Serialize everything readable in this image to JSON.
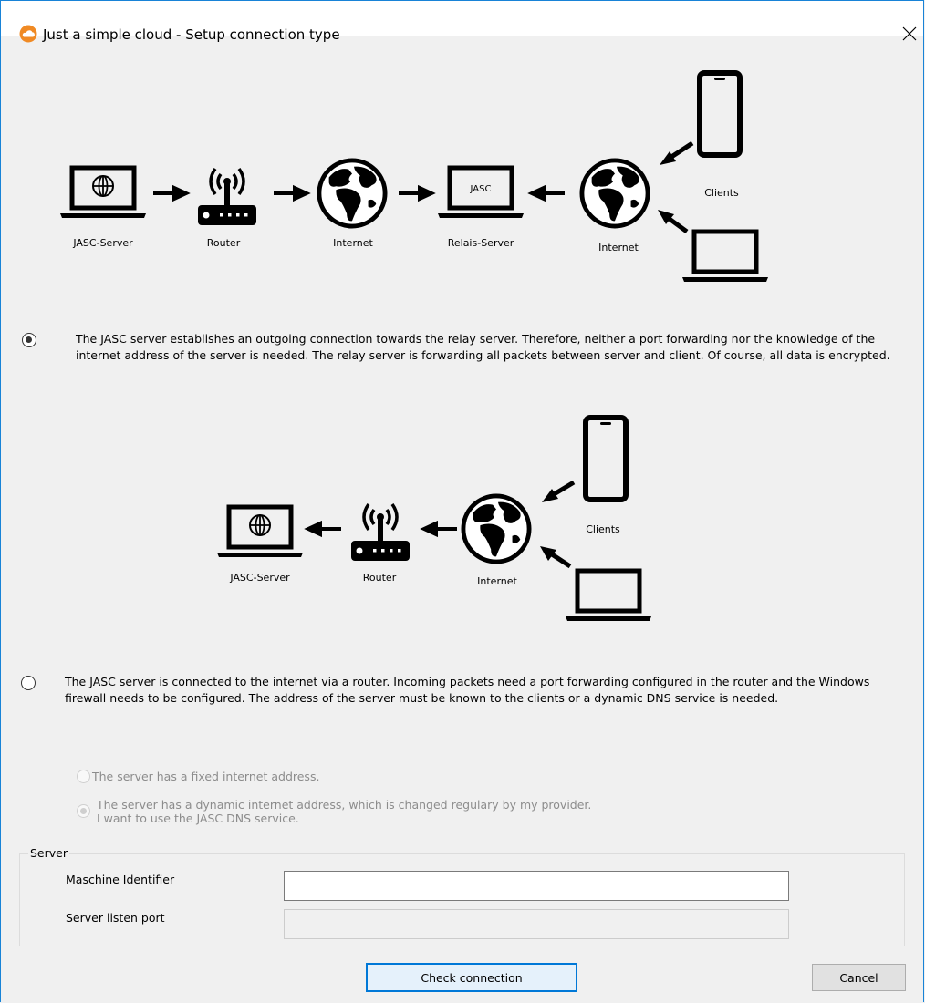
{
  "window": {
    "title": "Just a simple cloud - Setup connection type",
    "app_icon": "cloud-app-icon",
    "close_icon": "close-icon"
  },
  "diagram_relay": {
    "labels": {
      "jasc_server": "JASC-Server",
      "router": "Router",
      "internet_1": "Internet",
      "relais_server": "Relais-Server",
      "relais_screen": "JASC",
      "internet_2": "Internet",
      "clients": "Clients"
    }
  },
  "option_relay": {
    "selected": true,
    "text": "The JASC server establishes an outgoing connection towards the relay server. Therefore, neither a port forwarding nor the knowledge of the internet address of the server is needed. The relay server is forwarding all packets between server and client. Of course, all data is encrypted."
  },
  "diagram_direct": {
    "labels": {
      "jasc_server": "JASC-Server",
      "router": "Router",
      "internet": "Internet",
      "clients": "Clients"
    }
  },
  "option_direct": {
    "selected": false,
    "text": "The JASC server is connected to the internet via a router. Incoming packets need a port forwarding configured in the router and the Windows firewall needs to be configured. The address of the server must be known to the clients or a dynamic DNS service is needed."
  },
  "address_options": {
    "fixed": {
      "label": "The server has a fixed internet address.",
      "selected": false,
      "enabled": false
    },
    "dynamic": {
      "label_line1": "The server has a dynamic internet address, which is changed regulary by my provider.",
      "label_line2": "I want to use the JASC DNS service.",
      "selected": true,
      "enabled": false
    }
  },
  "server_group": {
    "legend": "Server",
    "machine_identifier": {
      "label": "Maschine Identifier",
      "value": "",
      "enabled": true
    },
    "listen_port": {
      "label": "Server listen port",
      "value": "",
      "enabled": false
    }
  },
  "buttons": {
    "check_connection": "Check connection",
    "cancel": "Cancel"
  }
}
